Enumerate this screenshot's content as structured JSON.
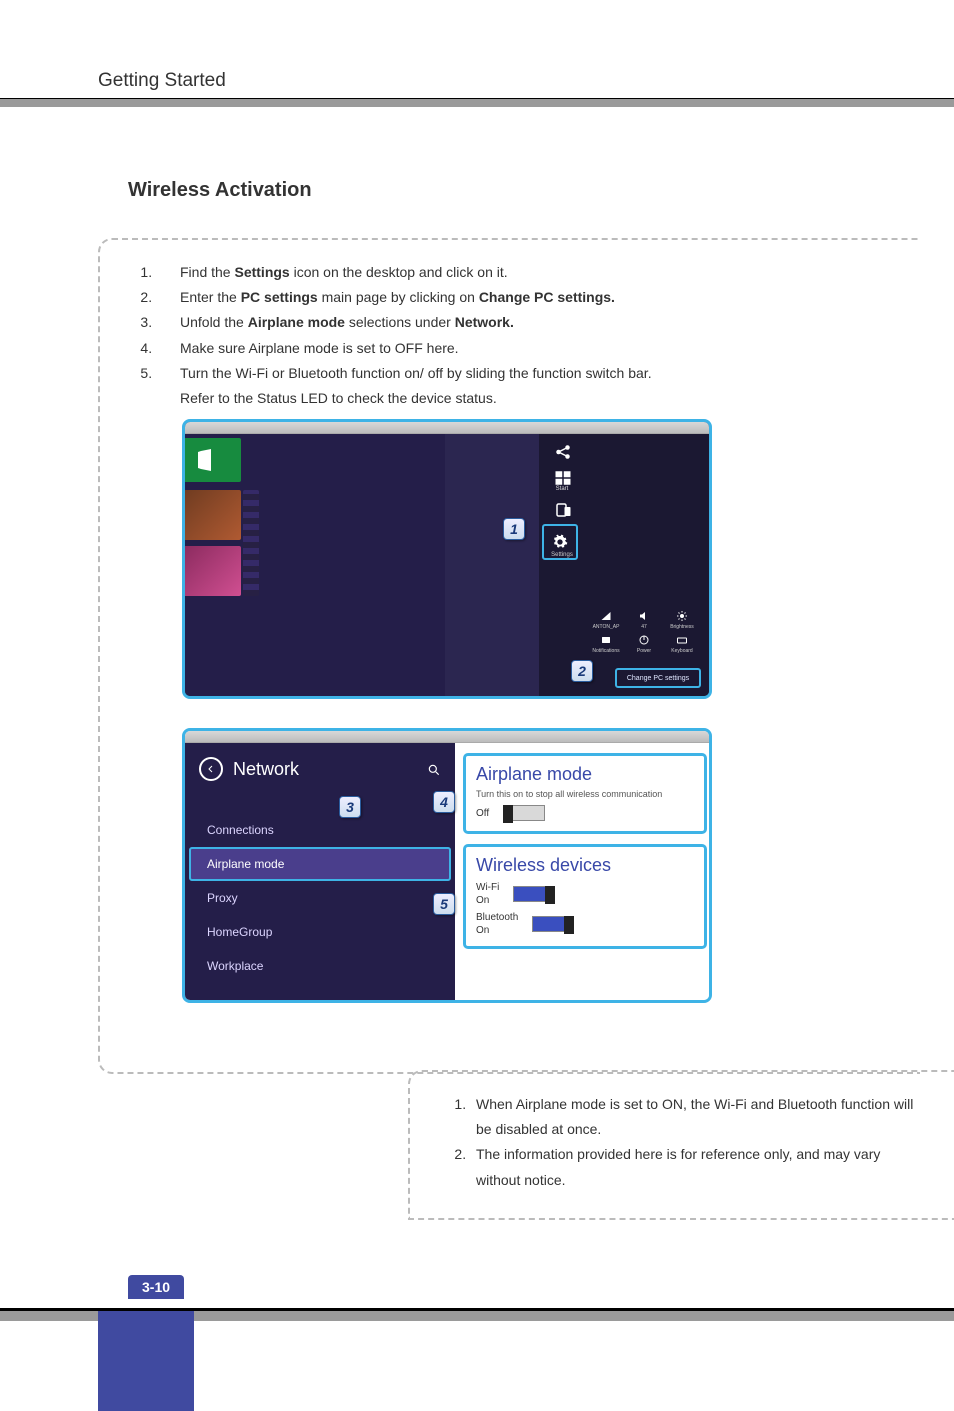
{
  "chapter": "Getting Started",
  "section_title": "Wireless Activation",
  "page_number": "3-10",
  "steps": [
    {
      "pre": "Find the ",
      "bold": "Settings",
      "post": " icon on the desktop and click on it."
    },
    {
      "pre": "Enter the ",
      "bold": "PC settings",
      "mid": " main page by clicking on ",
      "bold2": "Change PC settings.",
      "post": ""
    },
    {
      "pre": "Unfold the ",
      "bold": "Airplane mode",
      "mid": " selections under ",
      "bold2": "Network.",
      "post": ""
    },
    {
      "text": "Make sure Airplane mode is set to OFF here."
    },
    {
      "text": "Turn the Wi-Fi or Bluetooth function on/ off by sliding the function switch bar.",
      "sub": "Refer to the Status LED to check the device status."
    }
  ],
  "callouts": {
    "c1": "1",
    "c2": "2",
    "c3": "3",
    "c4": "4",
    "c5": "5"
  },
  "shot1": {
    "charms": {
      "share": "Share",
      "start": "Start",
      "devices": "Devices",
      "settings": "Settings"
    },
    "quick": {
      "network": "ANTON_AP",
      "volume": "47",
      "brightness": "Brightness",
      "notifications": "Notifications",
      "power": "Power",
      "keyboard": "Keyboard"
    },
    "change_pc": "Change PC settings"
  },
  "shot2": {
    "nav_title": "Network",
    "nav_items": [
      "Connections",
      "Airplane mode",
      "Proxy",
      "HomeGroup",
      "Workplace"
    ],
    "airplane": {
      "title": "Airplane mode",
      "desc": "Turn this on to stop all wireless communication",
      "state_label": "Off"
    },
    "wireless": {
      "title": "Wireless devices",
      "wifi_label": "Wi-Fi",
      "wifi_state": "On",
      "bt_label": "Bluetooth",
      "bt_state": "On"
    }
  },
  "notes": [
    "When Airplane mode is set to ON, the Wi-Fi and Bluetooth function will be disabled at once.",
    "The information provided here is for reference only, and may vary without notice."
  ]
}
